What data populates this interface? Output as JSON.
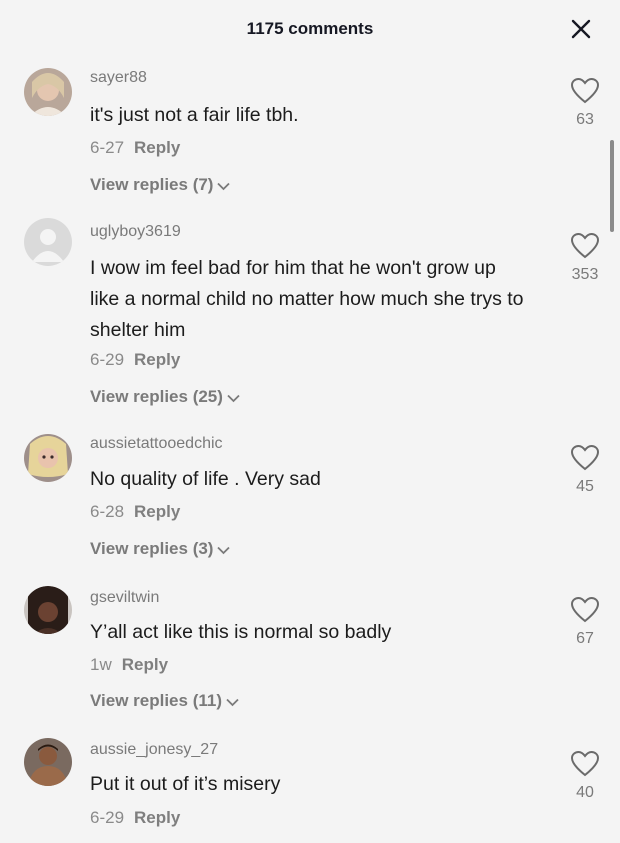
{
  "header": {
    "title": "1175 comments",
    "close_icon": "close-icon"
  },
  "comments": [
    {
      "username": "sayer88",
      "text": "it's just not a fair life tbh.",
      "date": "6-27",
      "reply_label": "Reply",
      "view_replies": "View replies (7)",
      "likes": "63"
    },
    {
      "username": "uglyboy3619",
      "text": "I wow im feel bad for him that he won't grow up like a normal child no matter how much she trys to shelter him",
      "date": "6-29",
      "reply_label": "Reply",
      "view_replies": "View replies (25)",
      "likes": "353"
    },
    {
      "username": "aussietattooedchic",
      "text": "No quality of life . Very sad",
      "date": "6-28",
      "reply_label": "Reply",
      "view_replies": "View replies (3)",
      "likes": "45"
    },
    {
      "username": "gseviltwin",
      "text": "Y’all act like this is normal so badly",
      "date": "1w",
      "reply_label": "Reply",
      "view_replies": "View replies (11)",
      "likes": "67"
    },
    {
      "username": "aussie_jonesy_27",
      "text": "Put it out of it’s misery",
      "date": "6-29",
      "reply_label": "Reply",
      "likes": "40"
    }
  ],
  "icons": {
    "like": "heart-outline-icon",
    "chevron": "chevron-down-icon"
  }
}
